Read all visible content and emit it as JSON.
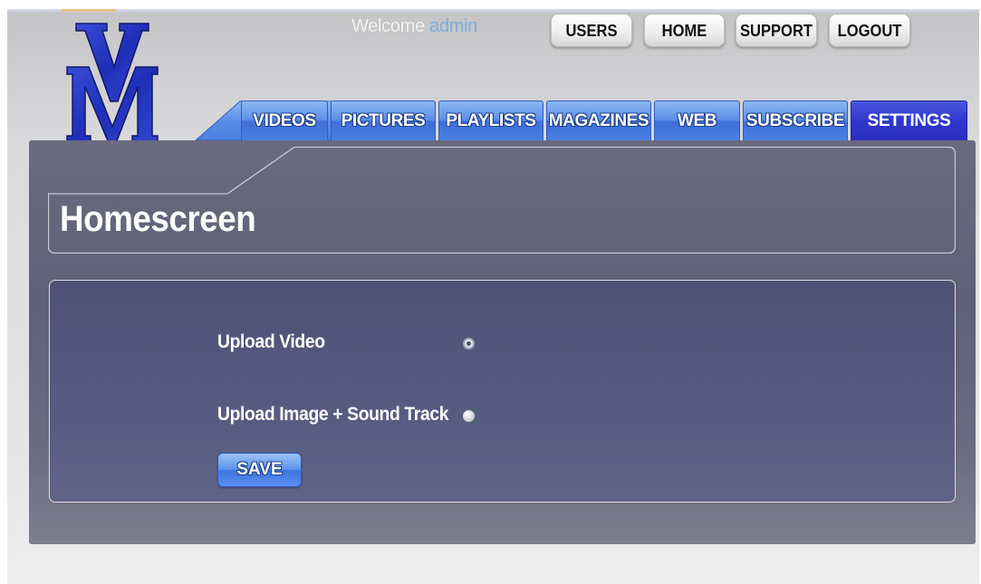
{
  "header": {
    "logo": {
      "text": "VM",
      "icon": "vm-monogram-logo"
    },
    "welcome": {
      "prefix": "Welcome",
      "username": "admin"
    },
    "top_nav": [
      "USERS",
      "HOME",
      "SUPPORT",
      "LOGOUT"
    ]
  },
  "tabs": [
    {
      "label": "VIDEOS",
      "active": false
    },
    {
      "label": "PICTURES",
      "active": false
    },
    {
      "label": "PLAYLISTS",
      "active": false
    },
    {
      "label": "MAGAZINES",
      "active": false
    },
    {
      "label": "WEB",
      "active": false
    },
    {
      "label": "SUBSCRIBE",
      "active": false
    },
    {
      "label": "SETTINGS",
      "active": true
    }
  ],
  "page": {
    "title": "Homescreen",
    "options": [
      {
        "label": "Upload Video",
        "selected": true
      },
      {
        "label": "Upload Image + Sound Track",
        "selected": false
      }
    ],
    "save_label": "SAVE"
  },
  "colors": {
    "tab_blue": "#4b7fe2",
    "tab_active": "#2f37cc",
    "panel": "#5f6076",
    "welcome_user": "#7fb0e6"
  }
}
